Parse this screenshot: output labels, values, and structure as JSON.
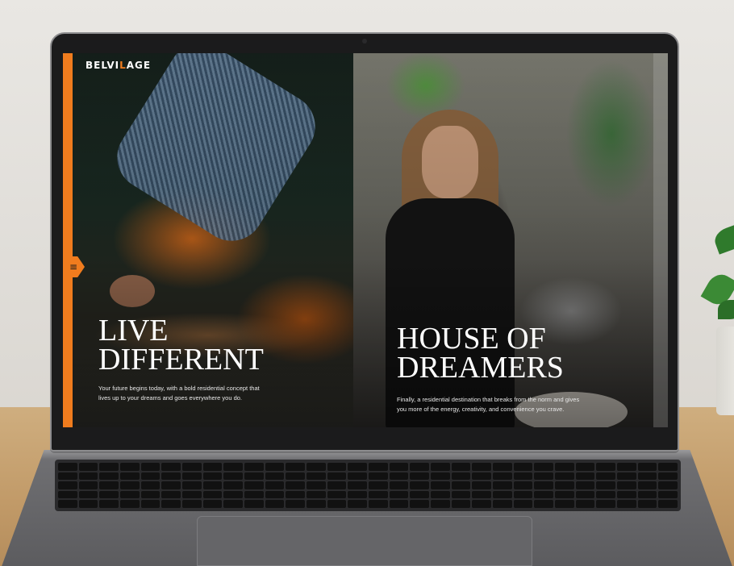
{
  "site": {
    "logo_prefix": "BELVI",
    "logo_accent": "L",
    "logo_suffix": "AGE",
    "menu_icon": "hamburger-icon",
    "accent_color": "#f07c1e"
  },
  "panels": [
    {
      "headline_line1": "LIVE",
      "headline_line2": "DIFFERENT",
      "blurb": "Your future begins today, with a bold residential concept that lives up to your dreams and goes everywhere you do."
    },
    {
      "headline_line1": "HOUSE OF",
      "headline_line2": "DREAMERS",
      "blurb": "Finally, a residential destination that breaks from the norm and gives you more of the energy, creativity, and convenience you crave."
    }
  ]
}
